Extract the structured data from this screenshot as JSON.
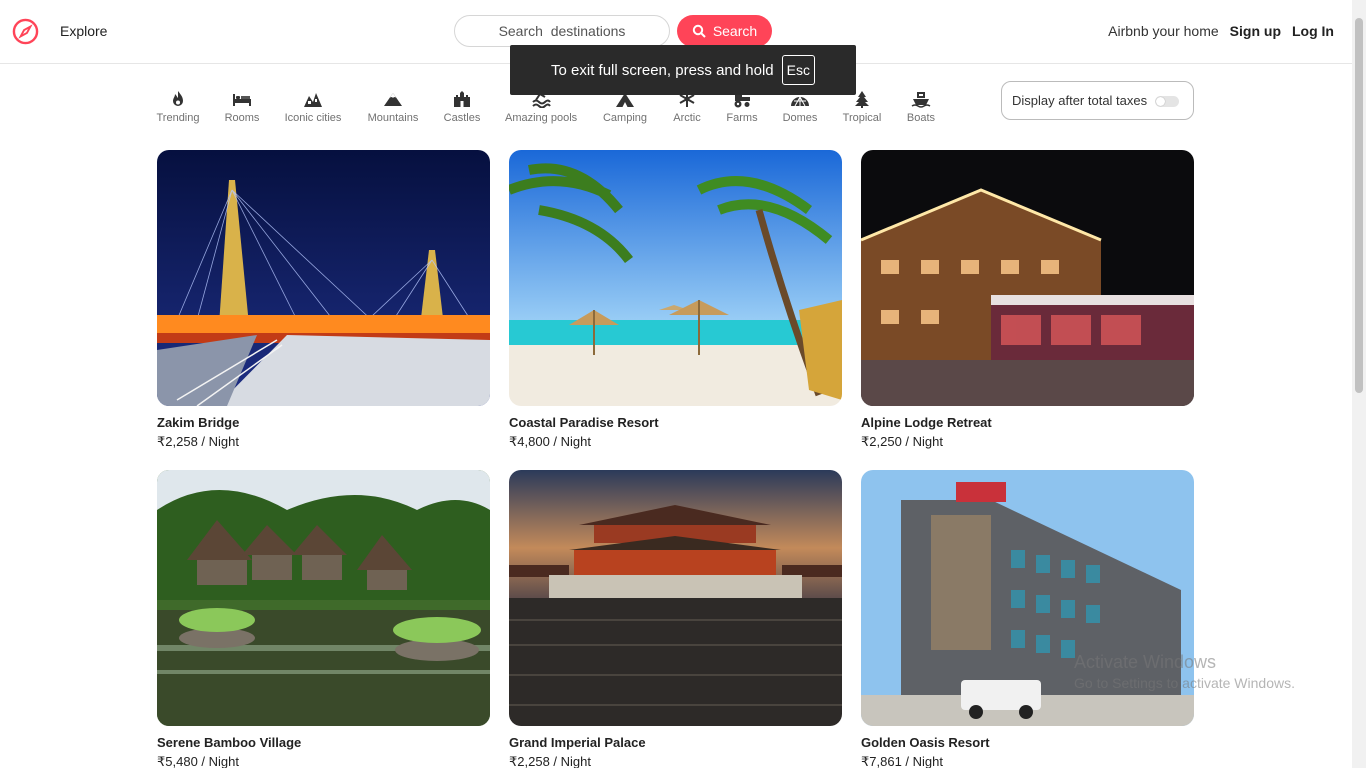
{
  "nav": {
    "explore": "Explore",
    "search_placeholder": "Search  destinations",
    "search_button": "Search",
    "host_link": "Airbnb your home",
    "signup": "Sign up",
    "login": "Log In"
  },
  "fullscreen_notice": {
    "text": "To exit full screen, press and hold",
    "key": "Esc"
  },
  "categories": [
    {
      "label": "Trending",
      "icon": "flame-icon"
    },
    {
      "label": "Rooms",
      "icon": "bed-icon"
    },
    {
      "label": "Iconic cities",
      "icon": "city-icon"
    },
    {
      "label": "Mountains",
      "icon": "mountain-icon"
    },
    {
      "label": "Castles",
      "icon": "castle-icon"
    },
    {
      "label": "Amazing pools",
      "icon": "pool-icon"
    },
    {
      "label": "Camping",
      "icon": "tent-icon"
    },
    {
      "label": "Arctic",
      "icon": "snowflake-icon"
    },
    {
      "label": "Farms",
      "icon": "tractor-icon"
    },
    {
      "label": "Domes",
      "icon": "dome-icon"
    },
    {
      "label": "Tropical",
      "icon": "palm-icon"
    },
    {
      "label": "Boats",
      "icon": "boat-icon"
    }
  ],
  "tax_toggle": {
    "label": "Display after total taxes",
    "on": false
  },
  "listings": [
    {
      "title": "Zakim Bridge",
      "price": "₹2,258 / Night"
    },
    {
      "title": "Coastal Paradise Resort",
      "price": "₹4,800 / Night"
    },
    {
      "title": "Alpine Lodge Retreat",
      "price": "₹2,250 / Night"
    },
    {
      "title": "Serene Bamboo Village",
      "price": "₹5,480 / Night"
    },
    {
      "title": "Grand Imperial Palace",
      "price": "₹2,258 / Night"
    },
    {
      "title": "Golden Oasis Resort",
      "price": "₹7,861 / Night"
    }
  ],
  "watermark": {
    "line1": "Activate Windows",
    "line2": "Go to Settings to activate Windows."
  },
  "colors": {
    "accent": "#ff4458"
  }
}
